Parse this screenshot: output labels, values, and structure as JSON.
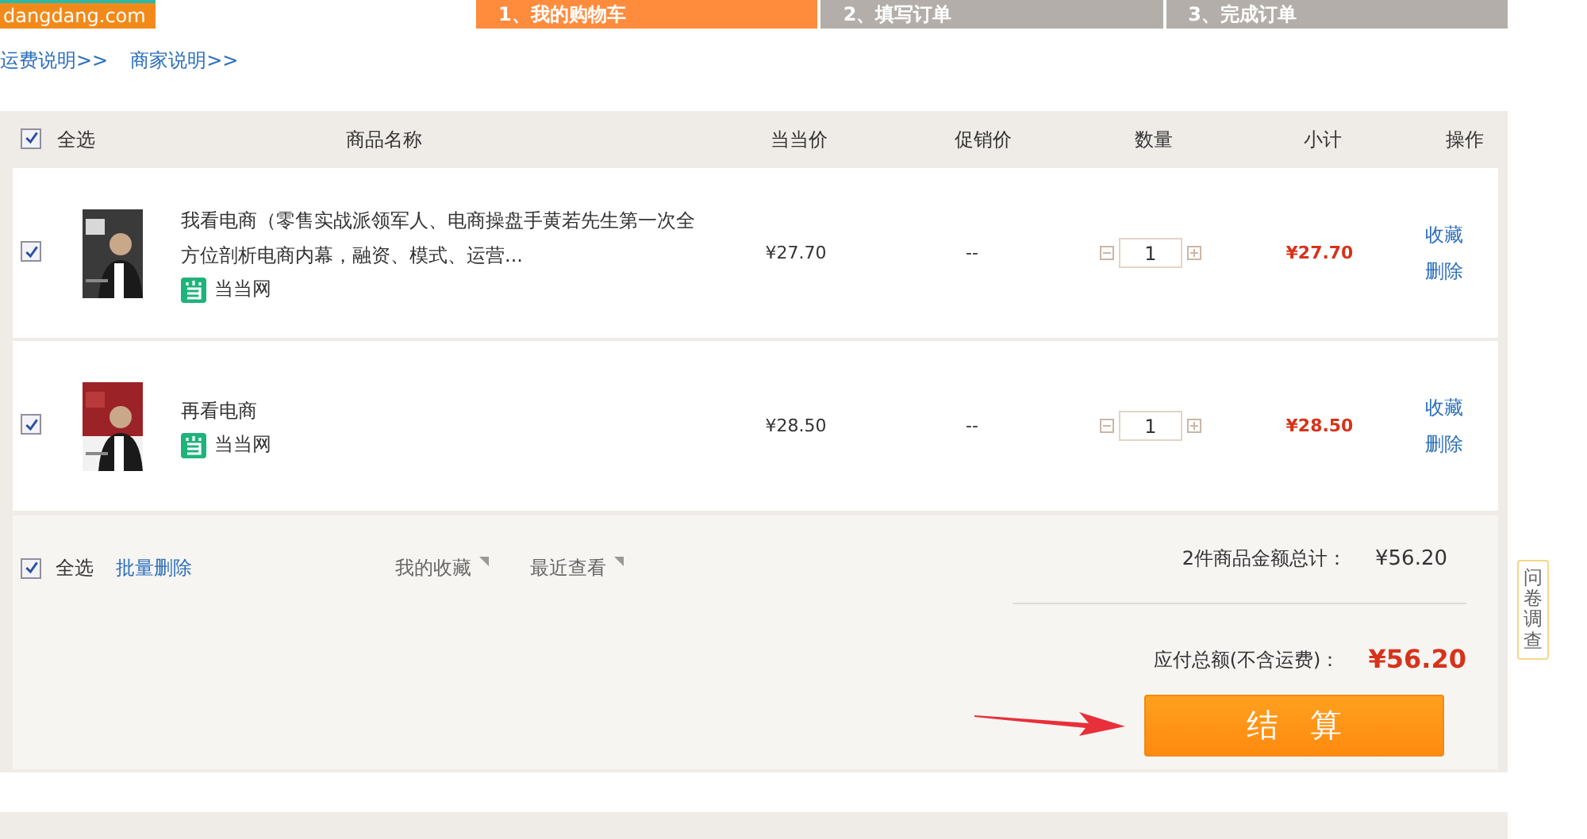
{
  "logo": {
    "text": "dangdang.com"
  },
  "steps": [
    {
      "label": "1、我的购物车",
      "selected": true
    },
    {
      "label": "2、填写订单",
      "selected": false
    },
    {
      "label": "3、完成订单",
      "selected": false
    }
  ],
  "links": [
    "运费说明>>",
    "商家说明>>"
  ],
  "header": {
    "select_all": {
      "label": "全选",
      "checked": true
    },
    "columns": [
      "商品名称",
      "当当价",
      "促销价",
      "数量",
      "小计",
      "操作"
    ]
  },
  "items": [
    {
      "checked": true,
      "title": "我看电商（零售实战派领军人、电商操盘手黄若先生第一次全方位剖析电商内幕，融资、模式、运营...",
      "shop": "当当网",
      "price": "¥27.70",
      "promo_price": "--",
      "quantity": "1",
      "subtotal": "¥27.70",
      "actions": [
        "收藏",
        "删除"
      ]
    },
    {
      "checked": true,
      "title": "再看电商",
      "shop": "当当网",
      "price": "¥28.50",
      "promo_price": "--",
      "quantity": "1",
      "subtotal": "¥28.50",
      "actions": [
        "收藏",
        "删除"
      ]
    }
  ],
  "footer": {
    "select_all": {
      "label": "全选",
      "checked": true
    },
    "batch_delete": "批量删除",
    "tabs": [
      "我的收藏",
      "最近查看"
    ],
    "total_label": "2件商品金额总计：",
    "total": "¥56.20",
    "payable_label": "应付总额(不含运费)：",
    "payable": "¥56.20",
    "checkout": "结　算"
  },
  "survey": "问卷调查"
}
